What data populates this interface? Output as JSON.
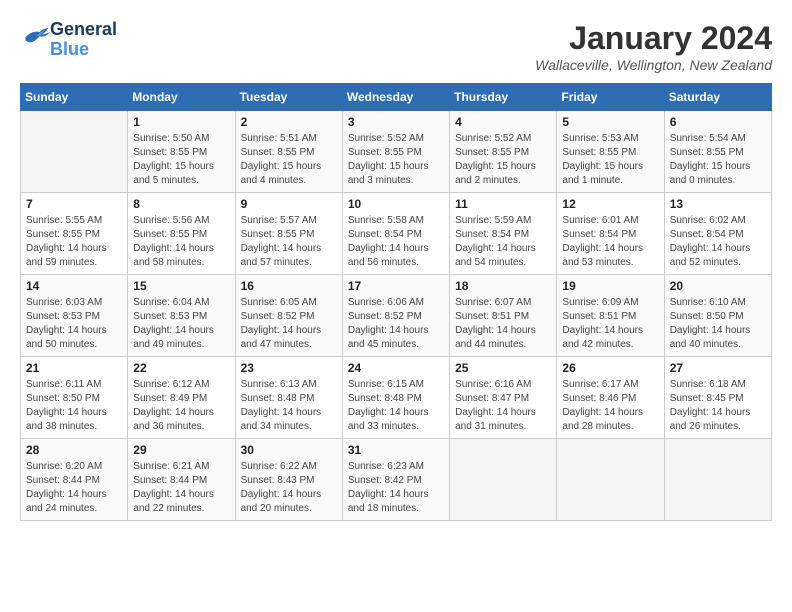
{
  "header": {
    "logo_line1": "General",
    "logo_line2": "Blue",
    "month_title": "January 2024",
    "location": "Wallaceville, Wellington, New Zealand"
  },
  "weekdays": [
    "Sunday",
    "Monday",
    "Tuesday",
    "Wednesday",
    "Thursday",
    "Friday",
    "Saturday"
  ],
  "weeks": [
    [
      {
        "day": "",
        "info": ""
      },
      {
        "day": "1",
        "info": "Sunrise: 5:50 AM\nSunset: 8:55 PM\nDaylight: 15 hours\nand 5 minutes."
      },
      {
        "day": "2",
        "info": "Sunrise: 5:51 AM\nSunset: 8:55 PM\nDaylight: 15 hours\nand 4 minutes."
      },
      {
        "day": "3",
        "info": "Sunrise: 5:52 AM\nSunset: 8:55 PM\nDaylight: 15 hours\nand 3 minutes."
      },
      {
        "day": "4",
        "info": "Sunrise: 5:52 AM\nSunset: 8:55 PM\nDaylight: 15 hours\nand 2 minutes."
      },
      {
        "day": "5",
        "info": "Sunrise: 5:53 AM\nSunset: 8:55 PM\nDaylight: 15 hours\nand 1 minute."
      },
      {
        "day": "6",
        "info": "Sunrise: 5:54 AM\nSunset: 8:55 PM\nDaylight: 15 hours\nand 0 minutes."
      }
    ],
    [
      {
        "day": "7",
        "info": "Sunrise: 5:55 AM\nSunset: 8:55 PM\nDaylight: 14 hours\nand 59 minutes."
      },
      {
        "day": "8",
        "info": "Sunrise: 5:56 AM\nSunset: 8:55 PM\nDaylight: 14 hours\nand 58 minutes."
      },
      {
        "day": "9",
        "info": "Sunrise: 5:57 AM\nSunset: 8:55 PM\nDaylight: 14 hours\nand 57 minutes."
      },
      {
        "day": "10",
        "info": "Sunrise: 5:58 AM\nSunset: 8:54 PM\nDaylight: 14 hours\nand 56 minutes."
      },
      {
        "day": "11",
        "info": "Sunrise: 5:59 AM\nSunset: 8:54 PM\nDaylight: 14 hours\nand 54 minutes."
      },
      {
        "day": "12",
        "info": "Sunrise: 6:01 AM\nSunset: 8:54 PM\nDaylight: 14 hours\nand 53 minutes."
      },
      {
        "day": "13",
        "info": "Sunrise: 6:02 AM\nSunset: 8:54 PM\nDaylight: 14 hours\nand 52 minutes."
      }
    ],
    [
      {
        "day": "14",
        "info": "Sunrise: 6:03 AM\nSunset: 8:53 PM\nDaylight: 14 hours\nand 50 minutes."
      },
      {
        "day": "15",
        "info": "Sunrise: 6:04 AM\nSunset: 8:53 PM\nDaylight: 14 hours\nand 49 minutes."
      },
      {
        "day": "16",
        "info": "Sunrise: 6:05 AM\nSunset: 8:52 PM\nDaylight: 14 hours\nand 47 minutes."
      },
      {
        "day": "17",
        "info": "Sunrise: 6:06 AM\nSunset: 8:52 PM\nDaylight: 14 hours\nand 45 minutes."
      },
      {
        "day": "18",
        "info": "Sunrise: 6:07 AM\nSunset: 8:51 PM\nDaylight: 14 hours\nand 44 minutes."
      },
      {
        "day": "19",
        "info": "Sunrise: 6:09 AM\nSunset: 8:51 PM\nDaylight: 14 hours\nand 42 minutes."
      },
      {
        "day": "20",
        "info": "Sunrise: 6:10 AM\nSunset: 8:50 PM\nDaylight: 14 hours\nand 40 minutes."
      }
    ],
    [
      {
        "day": "21",
        "info": "Sunrise: 6:11 AM\nSunset: 8:50 PM\nDaylight: 14 hours\nand 38 minutes."
      },
      {
        "day": "22",
        "info": "Sunrise: 6:12 AM\nSunset: 8:49 PM\nDaylight: 14 hours\nand 36 minutes."
      },
      {
        "day": "23",
        "info": "Sunrise: 6:13 AM\nSunset: 8:48 PM\nDaylight: 14 hours\nand 34 minutes."
      },
      {
        "day": "24",
        "info": "Sunrise: 6:15 AM\nSunset: 8:48 PM\nDaylight: 14 hours\nand 33 minutes."
      },
      {
        "day": "25",
        "info": "Sunrise: 6:16 AM\nSunset: 8:47 PM\nDaylight: 14 hours\nand 31 minutes."
      },
      {
        "day": "26",
        "info": "Sunrise: 6:17 AM\nSunset: 8:46 PM\nDaylight: 14 hours\nand 28 minutes."
      },
      {
        "day": "27",
        "info": "Sunrise: 6:18 AM\nSunset: 8:45 PM\nDaylight: 14 hours\nand 26 minutes."
      }
    ],
    [
      {
        "day": "28",
        "info": "Sunrise: 6:20 AM\nSunset: 8:44 PM\nDaylight: 14 hours\nand 24 minutes."
      },
      {
        "day": "29",
        "info": "Sunrise: 6:21 AM\nSunset: 8:44 PM\nDaylight: 14 hours\nand 22 minutes."
      },
      {
        "day": "30",
        "info": "Sunrise: 6:22 AM\nSunset: 8:43 PM\nDaylight: 14 hours\nand 20 minutes."
      },
      {
        "day": "31",
        "info": "Sunrise: 6:23 AM\nSunset: 8:42 PM\nDaylight: 14 hours\nand 18 minutes."
      },
      {
        "day": "",
        "info": ""
      },
      {
        "day": "",
        "info": ""
      },
      {
        "day": "",
        "info": ""
      }
    ]
  ]
}
